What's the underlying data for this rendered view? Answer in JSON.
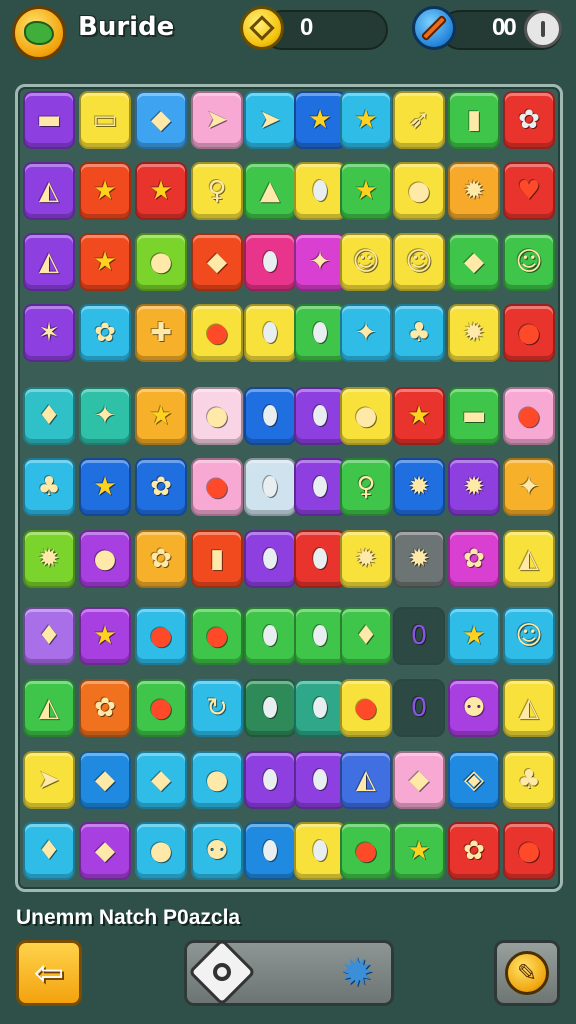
{
  "header": {
    "title": "Buride",
    "coins": "0",
    "tools": "00",
    "logo_icon": "leaf-icon",
    "coin_icon": "coin-icon",
    "tool_icon": "pencil-icon"
  },
  "board": {
    "rows": [
      [
        {
          "c": "#8e3fe0",
          "g": "▬",
          "k": "card"
        },
        {
          "c": "#f7e13a",
          "g": "▭",
          "k": "card"
        },
        {
          "c": "#3ea3f0",
          "g": "◆",
          "k": "leaf"
        },
        {
          "c": "#f7a9d4",
          "g": "➤",
          "k": "plane"
        },
        {
          "c": "#2fbde8",
          "g": "➤",
          "k": "plane"
        },
        {
          "c": "#1f6fe0",
          "g": "★",
          "k": "star"
        },
        {
          "c": "#2fbde8",
          "g": "★",
          "k": "star"
        },
        {
          "c": "#f7e13a",
          "g": "➶",
          "k": "rocket"
        },
        {
          "c": "#3fc54a",
          "g": "▮",
          "k": "card"
        },
        {
          "c": "#e8342c",
          "g": "✿",
          "k": "ring"
        }
      ],
      [
        {
          "c": "#8e3fe0",
          "g": "◭",
          "k": "plane"
        },
        {
          "c": "#f04a1e",
          "g": "★",
          "k": "star"
        },
        {
          "c": "#e8342c",
          "g": "★",
          "k": "star"
        },
        {
          "c": "#f7e13a",
          "g": "♀",
          "k": "key"
        },
        {
          "c": "#3fc54a",
          "g": "▲",
          "k": "bottle"
        },
        {
          "c": "#f7e13a",
          "g": "⬮",
          "k": "ring"
        },
        {
          "c": "#3fc54a",
          "g": "★",
          "k": "star"
        },
        {
          "c": "#f7e13a",
          "g": "●",
          "k": "bird"
        },
        {
          "c": "#f7a92a",
          "g": "✹",
          "k": "gear"
        },
        {
          "c": "#e8342c",
          "g": "♥",
          "k": "heart"
        }
      ],
      [
        {
          "c": "#8e3fe0",
          "g": "◭",
          "k": "plane"
        },
        {
          "c": "#f04a1e",
          "g": "★",
          "k": "star"
        },
        {
          "c": "#7bd42c",
          "g": "●",
          "k": "bird"
        },
        {
          "c": "#f04a1e",
          "g": "◆",
          "k": "gem"
        },
        {
          "c": "#e8348a",
          "g": "⬮",
          "k": "ring"
        },
        {
          "c": "#d93fd0",
          "g": "✦",
          "k": "splash"
        },
        {
          "c": "#f7e13a",
          "g": "☺",
          "k": "face"
        },
        {
          "c": "#f7e13a",
          "g": "☺",
          "k": "face"
        },
        {
          "c": "#3fc54a",
          "g": "◆",
          "k": "leaf"
        },
        {
          "c": "#3fc54a",
          "g": "☺",
          "k": "face"
        }
      ],
      [
        {
          "c": "#8e3fe0",
          "g": "✶",
          "k": "card"
        },
        {
          "c": "#2fbde8",
          "g": "✿",
          "k": "flower"
        },
        {
          "c": "#f7b02a",
          "g": "✚",
          "k": "cross"
        },
        {
          "c": "#f7e13a",
          "g": "●",
          "k": "apple"
        },
        {
          "c": "#f7e13a",
          "g": "⬮",
          "k": "pin"
        },
        {
          "c": "#3fc54a",
          "g": "⬮",
          "k": "pin"
        },
        {
          "c": "#2fbde8",
          "g": "✦",
          "k": "star4"
        },
        {
          "c": "#2fbde8",
          "g": "♣",
          "k": "puzzle"
        },
        {
          "c": "#f7e13a",
          "g": "✹",
          "k": "gear"
        },
        {
          "c": "#e8342c",
          "g": "●",
          "k": "ball"
        }
      ],
      [
        {
          "c": "#2fc0c8",
          "g": "♦",
          "k": "leaf"
        },
        {
          "c": "#2fc0a8",
          "g": "✦",
          "k": "splash"
        },
        {
          "c": "#f7b02a",
          "g": "★",
          "k": "star"
        },
        {
          "c": "#f9d4e4",
          "g": "●",
          "k": "blob"
        },
        {
          "c": "#1f6fe0",
          "g": "⬮",
          "k": "pin"
        },
        {
          "c": "#8e3fe0",
          "g": "⬮",
          "k": "pin"
        },
        {
          "c": "#f7e13a",
          "g": "●",
          "k": "jar"
        },
        {
          "c": "#e8342c",
          "g": "★",
          "k": "star"
        },
        {
          "c": "#3fc54a",
          "g": "▬",
          "k": "card"
        },
        {
          "c": "#f7a9d4",
          "g": "●",
          "k": "ball"
        }
      ],
      [
        {
          "c": "#2fbde8",
          "g": "♣",
          "k": "puzzle"
        },
        {
          "c": "#1f6fe0",
          "g": "★",
          "k": "star"
        },
        {
          "c": "#1f6fe0",
          "g": "✿",
          "k": "flower"
        },
        {
          "c": "#f7a9d4",
          "g": "●",
          "k": "apple"
        },
        {
          "c": "#cfe3ef",
          "g": "⬮",
          "k": "pin"
        },
        {
          "c": "#8e3fe0",
          "g": "⬮",
          "k": "pin"
        },
        {
          "c": "#3fc54a",
          "g": "♀",
          "k": "key"
        },
        {
          "c": "#1f6fe0",
          "g": "✹",
          "k": "gear"
        },
        {
          "c": "#8e3fe0",
          "g": "✹",
          "k": "gear"
        },
        {
          "c": "#f7b02a",
          "g": "✦",
          "k": "splash"
        }
      ],
      [
        {
          "c": "#7bd42c",
          "g": "✹",
          "k": "splat"
        },
        {
          "c": "#a83fe0",
          "g": "●",
          "k": "bubble"
        },
        {
          "c": "#f7b02a",
          "g": "✿",
          "k": "flower"
        },
        {
          "c": "#f04a1e",
          "g": "▮",
          "k": "bar"
        },
        {
          "c": "#8e3fe0",
          "g": "⬮",
          "k": "ring"
        },
        {
          "c": "#e8342c",
          "g": "⬮",
          "k": "ring"
        },
        {
          "c": "#f7e13a",
          "g": "✹",
          "k": "gear"
        },
        {
          "c": "#6c7573",
          "g": "✹",
          "k": "gear"
        },
        {
          "c": "#d93fd0",
          "g": "✿",
          "k": "flower"
        },
        {
          "c": "#f7e13a",
          "g": "◭",
          "k": "plane"
        }
      ],
      [
        {
          "c": "#a86fe8",
          "g": "♦",
          "k": "leaf"
        },
        {
          "c": "#a83fe0",
          "g": "★",
          "k": "star"
        },
        {
          "c": "#2fbde8",
          "g": "●",
          "k": "apple"
        },
        {
          "c": "#3fc54a",
          "g": "●",
          "k": "ball"
        },
        {
          "c": "#3fc54a",
          "g": "⬮",
          "k": "pin"
        },
        {
          "c": "#3fc54a",
          "g": "⬮",
          "k": "pin"
        },
        {
          "c": "#3fc54a",
          "g": "♦",
          "k": "carrot"
        },
        {
          "c": "empty",
          "g": "0",
          "k": "empty"
        },
        {
          "c": "#2fbde8",
          "g": "★",
          "k": "star"
        },
        {
          "c": "#2fbde8",
          "g": "☺",
          "k": "face"
        }
      ],
      [
        {
          "c": "#3fc54a",
          "g": "◭",
          "k": "plane"
        },
        {
          "c": "#f0721e",
          "g": "✿",
          "k": "flower"
        },
        {
          "c": "#3fc54a",
          "g": "●",
          "k": "apple"
        },
        {
          "c": "#2fbde8",
          "g": "↻",
          "k": "swirl"
        },
        {
          "c": "#2f8a5a",
          "g": "⬮",
          "k": "pin"
        },
        {
          "c": "#2fa88a",
          "g": "⬮",
          "k": "pin"
        },
        {
          "c": "#f7e13a",
          "g": "●",
          "k": "apple"
        },
        {
          "c": "empty",
          "g": "0",
          "k": "empty"
        },
        {
          "c": "#a83fe0",
          "g": "⚉",
          "k": "face"
        },
        {
          "c": "#f7e13a",
          "g": "◭",
          "k": "plane"
        }
      ],
      [
        {
          "c": "#f7e13a",
          "g": "➤",
          "k": "plane"
        },
        {
          "c": "#1f8ae0",
          "g": "◆",
          "k": "gem"
        },
        {
          "c": "#2fbde8",
          "g": "◆",
          "k": "leaf"
        },
        {
          "c": "#2fbde8",
          "g": "●",
          "k": "blob"
        },
        {
          "c": "#8e3fe0",
          "g": "⬮",
          "k": "ring"
        },
        {
          "c": "#8e3fe0",
          "g": "⬮",
          "k": "ring"
        },
        {
          "c": "#3f6fe0",
          "g": "◭",
          "k": "plane"
        },
        {
          "c": "#f7a9d4",
          "g": "◆",
          "k": "gem"
        },
        {
          "c": "#1f8ae0",
          "g": "◈",
          "k": "diamond"
        },
        {
          "c": "#f7e13a",
          "g": "♣",
          "k": "puzzle"
        }
      ],
      [
        {
          "c": "#2fbde8",
          "g": "♦",
          "k": "leaf"
        },
        {
          "c": "#a83fe0",
          "g": "◆",
          "k": "gem"
        },
        {
          "c": "#2fbde8",
          "g": "●",
          "k": "bean"
        },
        {
          "c": "#2fbde8",
          "g": "⚉",
          "k": "face"
        },
        {
          "c": "#1f8ae0",
          "g": "⬮",
          "k": "ring"
        },
        {
          "c": "#f7e13a",
          "g": "⬮",
          "k": "pin"
        },
        {
          "c": "#3fc54a",
          "g": "●",
          "k": "ball"
        },
        {
          "c": "#3fc54a",
          "g": "★",
          "k": "star"
        },
        {
          "c": "#e8342c",
          "g": "✿",
          "k": "flower"
        },
        {
          "c": "#e8342c",
          "g": "●",
          "k": "ball"
        }
      ]
    ]
  },
  "footer": {
    "subtitle": "Unemm Natch P0azcla",
    "back_icon": "arrow-left-icon",
    "left_control_icon": "diamond-ring-icon",
    "right_control_icon": "gear-icon",
    "tool_button_icon": "pencil-badge-icon"
  }
}
